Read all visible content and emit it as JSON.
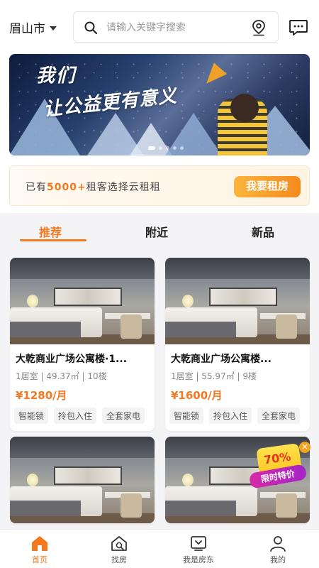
{
  "header": {
    "city": "眉山市",
    "search_placeholder": "请输入关键字搜索"
  },
  "banner": {
    "slogan_line1": "我们",
    "slogan_line2": "让公益更有意义",
    "slide_count": 5,
    "active_slide": 1
  },
  "promo": {
    "prefix": "已有",
    "highlight": "5000+",
    "suffix": "租客选择云租租",
    "button": "我要租房"
  },
  "tabs": [
    {
      "label": "推荐",
      "active": true
    },
    {
      "label": "附近",
      "active": false
    },
    {
      "label": "新品",
      "active": false
    }
  ],
  "listings": [
    {
      "title": "大乾商业广场公寓楼·1...",
      "meta": "1居室 | 49.37㎡ | 10楼",
      "price": "¥1280/月",
      "tags": [
        "智能锁",
        "拎包入住",
        "全套家电"
      ]
    },
    {
      "title": "大乾商业广场公寓楼...",
      "meta": "1居室 | 55.97㎡ | 9楼",
      "price": "¥1600/月",
      "tags": [
        "智能锁",
        "拎包入住",
        "全套家电"
      ]
    }
  ],
  "float_ad": {
    "percent": "70%",
    "label": "限时特价"
  },
  "bottom_nav": [
    {
      "label": "首页",
      "icon": "home-icon",
      "active": true
    },
    {
      "label": "找房",
      "icon": "house-search-icon",
      "active": false
    },
    {
      "label": "我是房东",
      "icon": "landlord-icon",
      "active": false
    },
    {
      "label": "我的",
      "icon": "user-icon",
      "active": false
    }
  ],
  "colors": {
    "accent": "#f5771e",
    "button_gradient_start": "#fbb53c",
    "button_gradient_end": "#f58a1f"
  }
}
